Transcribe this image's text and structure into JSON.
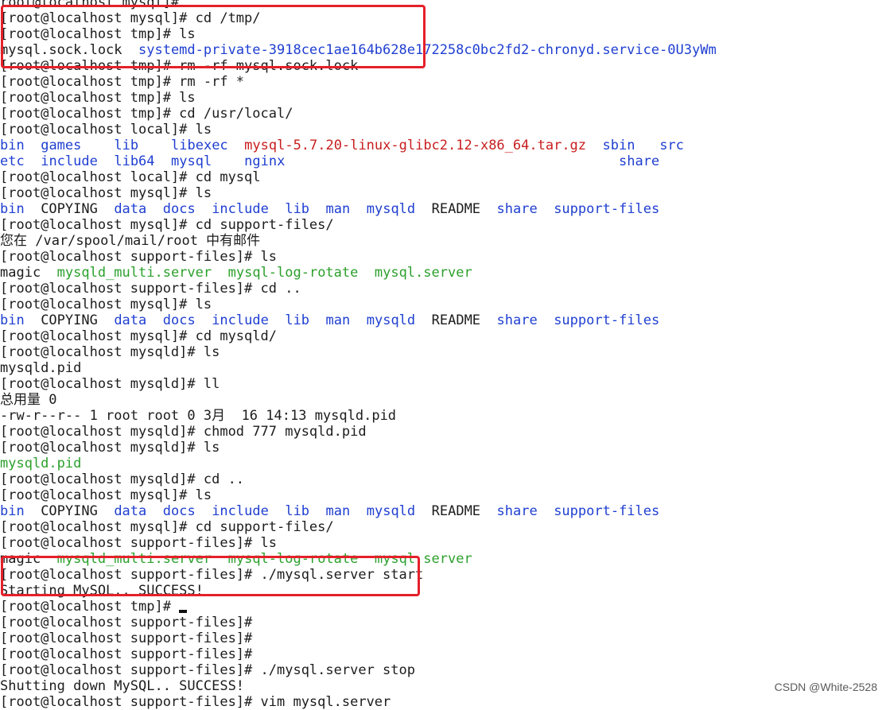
{
  "terminal": {
    "lines": [
      {
        "segs": [
          {
            "t": "root@localhost mysql]#",
            "c": "default"
          }
        ]
      },
      {
        "segs": [
          {
            "t": "[root@localhost mysql]# cd /tmp/",
            "c": "default"
          }
        ]
      },
      {
        "segs": [
          {
            "t": "[root@localhost tmp]# ls",
            "c": "default"
          }
        ]
      },
      {
        "segs": [
          {
            "t": "mysql.sock.lock  ",
            "c": "default"
          },
          {
            "t": "systemd-private-3918cec1ae164b628e172258c0bc2fd2-chronyd.service-0U3yWm",
            "c": "blue"
          }
        ]
      },
      {
        "segs": [
          {
            "t": "[root@localhost tmp]# rm -rf mysql.sock.lock",
            "c": "default"
          }
        ]
      },
      {
        "segs": [
          {
            "t": "[root@localhost tmp]# rm -rf *",
            "c": "default"
          }
        ]
      },
      {
        "segs": [
          {
            "t": "[root@localhost tmp]# ls",
            "c": "default"
          }
        ]
      },
      {
        "segs": [
          {
            "t": "[root@localhost tmp]# cd /usr/local/",
            "c": "default"
          }
        ]
      },
      {
        "segs": [
          {
            "t": "[root@localhost local]# ls",
            "c": "default"
          }
        ]
      },
      {
        "segs": [
          {
            "t": "bin",
            "c": "blue"
          },
          {
            "t": "  ",
            "c": "default"
          },
          {
            "t": "games",
            "c": "blue"
          },
          {
            "t": "    ",
            "c": "default"
          },
          {
            "t": "lib",
            "c": "blue"
          },
          {
            "t": "    ",
            "c": "default"
          },
          {
            "t": "libexec",
            "c": "blue"
          },
          {
            "t": "  ",
            "c": "default"
          },
          {
            "t": "mysql-5.7.20-linux-glibc2.12-x86_64.tar.gz",
            "c": "red"
          },
          {
            "t": "  ",
            "c": "default"
          },
          {
            "t": "sbin",
            "c": "blue"
          },
          {
            "t": "   ",
            "c": "default"
          },
          {
            "t": "src",
            "c": "blue"
          }
        ]
      },
      {
        "segs": [
          {
            "t": "etc",
            "c": "blue"
          },
          {
            "t": "  ",
            "c": "default"
          },
          {
            "t": "include",
            "c": "blue"
          },
          {
            "t": "  ",
            "c": "default"
          },
          {
            "t": "lib64",
            "c": "blue"
          },
          {
            "t": "  ",
            "c": "default"
          },
          {
            "t": "mysql",
            "c": "blue"
          },
          {
            "t": "    ",
            "c": "default"
          },
          {
            "t": "nginx",
            "c": "blue"
          },
          {
            "t": "                                         ",
            "c": "default"
          },
          {
            "t": "share",
            "c": "blue"
          }
        ]
      },
      {
        "segs": [
          {
            "t": "[root@localhost local]# cd mysql",
            "c": "default"
          }
        ]
      },
      {
        "segs": [
          {
            "t": "[root@localhost mysql]# ls",
            "c": "default"
          }
        ]
      },
      {
        "segs": [
          {
            "t": "bin",
            "c": "blue"
          },
          {
            "t": "  COPYING  ",
            "c": "default"
          },
          {
            "t": "data",
            "c": "blue"
          },
          {
            "t": "  ",
            "c": "default"
          },
          {
            "t": "docs",
            "c": "blue"
          },
          {
            "t": "  ",
            "c": "default"
          },
          {
            "t": "include",
            "c": "blue"
          },
          {
            "t": "  ",
            "c": "default"
          },
          {
            "t": "lib",
            "c": "blue"
          },
          {
            "t": "  ",
            "c": "default"
          },
          {
            "t": "man",
            "c": "blue"
          },
          {
            "t": "  ",
            "c": "default"
          },
          {
            "t": "mysqld",
            "c": "blue"
          },
          {
            "t": "  README  ",
            "c": "default"
          },
          {
            "t": "share",
            "c": "blue"
          },
          {
            "t": "  ",
            "c": "default"
          },
          {
            "t": "support-files",
            "c": "blue"
          }
        ]
      },
      {
        "segs": [
          {
            "t": "[root@localhost mysql]# cd support-files/",
            "c": "default"
          }
        ]
      },
      {
        "segs": [
          {
            "t": "您在 /var/spool/mail/root 中有邮件",
            "c": "default"
          }
        ]
      },
      {
        "segs": [
          {
            "t": "[root@localhost support-files]# ls",
            "c": "default"
          }
        ]
      },
      {
        "segs": [
          {
            "t": "magic  ",
            "c": "default"
          },
          {
            "t": "mysqld_multi.server",
            "c": "green"
          },
          {
            "t": "  ",
            "c": "default"
          },
          {
            "t": "mysql-log-rotate",
            "c": "green"
          },
          {
            "t": "  ",
            "c": "default"
          },
          {
            "t": "mysql.server",
            "c": "green"
          }
        ]
      },
      {
        "segs": [
          {
            "t": "[root@localhost support-files]# cd ..",
            "c": "default"
          }
        ]
      },
      {
        "segs": [
          {
            "t": "[root@localhost mysql]# ls",
            "c": "default"
          }
        ]
      },
      {
        "segs": [
          {
            "t": "bin",
            "c": "blue"
          },
          {
            "t": "  COPYING  ",
            "c": "default"
          },
          {
            "t": "data",
            "c": "blue"
          },
          {
            "t": "  ",
            "c": "default"
          },
          {
            "t": "docs",
            "c": "blue"
          },
          {
            "t": "  ",
            "c": "default"
          },
          {
            "t": "include",
            "c": "blue"
          },
          {
            "t": "  ",
            "c": "default"
          },
          {
            "t": "lib",
            "c": "blue"
          },
          {
            "t": "  ",
            "c": "default"
          },
          {
            "t": "man",
            "c": "blue"
          },
          {
            "t": "  ",
            "c": "default"
          },
          {
            "t": "mysqld",
            "c": "blue"
          },
          {
            "t": "  README  ",
            "c": "default"
          },
          {
            "t": "share",
            "c": "blue"
          },
          {
            "t": "  ",
            "c": "default"
          },
          {
            "t": "support-files",
            "c": "blue"
          }
        ]
      },
      {
        "segs": [
          {
            "t": "[root@localhost mysql]# cd mysqld/",
            "c": "default"
          }
        ]
      },
      {
        "segs": [
          {
            "t": "[root@localhost mysqld]# ls",
            "c": "default"
          }
        ]
      },
      {
        "segs": [
          {
            "t": "mysqld.pid",
            "c": "default"
          }
        ]
      },
      {
        "segs": [
          {
            "t": "[root@localhost mysqld]# ll",
            "c": "default"
          }
        ]
      },
      {
        "segs": [
          {
            "t": "总用量 0",
            "c": "default"
          }
        ]
      },
      {
        "segs": [
          {
            "t": "-rw-r--r-- 1 root root 0 3月  16 14:13 mysqld.pid",
            "c": "default"
          }
        ]
      },
      {
        "segs": [
          {
            "t": "[root@localhost mysqld]# chmod 777 mysqld.pid",
            "c": "default"
          }
        ]
      },
      {
        "segs": [
          {
            "t": "[root@localhost mysqld]# ls",
            "c": "default"
          }
        ]
      },
      {
        "segs": [
          {
            "t": "mysqld.pid",
            "c": "green"
          }
        ]
      },
      {
        "segs": [
          {
            "t": "[root@localhost mysqld]# cd ..",
            "c": "default"
          }
        ]
      },
      {
        "segs": [
          {
            "t": "[root@localhost mysql]# ls",
            "c": "default"
          }
        ]
      },
      {
        "segs": [
          {
            "t": "bin",
            "c": "blue"
          },
          {
            "t": "  COPYING  ",
            "c": "default"
          },
          {
            "t": "data",
            "c": "blue"
          },
          {
            "t": "  ",
            "c": "default"
          },
          {
            "t": "docs",
            "c": "blue"
          },
          {
            "t": "  ",
            "c": "default"
          },
          {
            "t": "include",
            "c": "blue"
          },
          {
            "t": "  ",
            "c": "default"
          },
          {
            "t": "lib",
            "c": "blue"
          },
          {
            "t": "  ",
            "c": "default"
          },
          {
            "t": "man",
            "c": "blue"
          },
          {
            "t": "  ",
            "c": "default"
          },
          {
            "t": "mysqld",
            "c": "blue"
          },
          {
            "t": "  README  ",
            "c": "default"
          },
          {
            "t": "share",
            "c": "blue"
          },
          {
            "t": "  ",
            "c": "default"
          },
          {
            "t": "support-files",
            "c": "blue"
          }
        ]
      },
      {
        "segs": [
          {
            "t": "[root@localhost mysql]# cd support-files/",
            "c": "default"
          }
        ]
      },
      {
        "segs": [
          {
            "t": "[root@localhost support-files]# ls",
            "c": "default"
          }
        ]
      },
      {
        "segs": [
          {
            "t": "magic  ",
            "c": "default"
          },
          {
            "t": "mysqld_multi.server",
            "c": "green"
          },
          {
            "t": "  ",
            "c": "default"
          },
          {
            "t": "mysql-log-rotate",
            "c": "green"
          },
          {
            "t": "  ",
            "c": "default"
          },
          {
            "t": "mysql.server",
            "c": "green"
          }
        ]
      },
      {
        "segs": [
          {
            "t": "[root@localhost support-files]# ./mysql.server start",
            "c": "default"
          }
        ]
      },
      {
        "segs": [
          {
            "t": "Starting MySQL.. SUCCESS!",
            "c": "default"
          }
        ]
      },
      {
        "segs": [
          {
            "t": "[root@localhost tmp]# ",
            "c": "default"
          }
        ],
        "cursor": true
      },
      {
        "segs": [
          {
            "t": "[root@localhost support-files]#",
            "c": "default"
          }
        ]
      },
      {
        "segs": [
          {
            "t": "[root@localhost support-files]#",
            "c": "default"
          }
        ]
      },
      {
        "segs": [
          {
            "t": "[root@localhost support-files]#",
            "c": "default"
          }
        ]
      },
      {
        "segs": [
          {
            "t": "[root@localhost support-files]# ./mysql.server stop",
            "c": "default"
          }
        ]
      },
      {
        "segs": [
          {
            "t": "Shutting down MySQL.. SUCCESS!",
            "c": "default"
          }
        ]
      },
      {
        "segs": [
          {
            "t": "[root@localhost support-files]# vim mysql.server",
            "c": "default"
          }
        ]
      }
    ]
  },
  "colors": {
    "default": "#1c1c1c",
    "blue": "#1f3fd1",
    "green": "#2ca02c",
    "red": "#c81e1e",
    "highlight_box": "#e5202a"
  },
  "watermark": "CSDN @White-2528"
}
